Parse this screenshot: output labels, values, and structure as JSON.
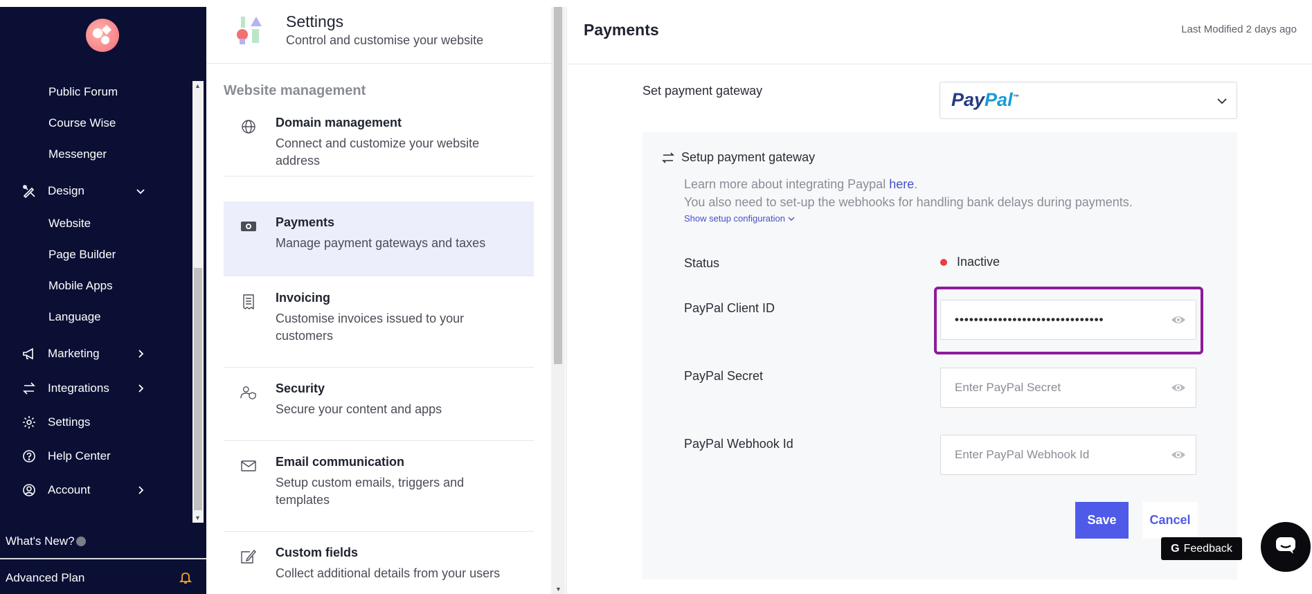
{
  "sidebar": {
    "sub_items_top": [
      "Public Forum",
      "Course Wise",
      "Messenger"
    ],
    "design": {
      "label": "Design",
      "icon": "design-pencil-icon",
      "expanded": true
    },
    "design_sub_items": [
      "Website",
      "Page Builder",
      "Mobile Apps",
      "Language"
    ],
    "main_items": [
      {
        "label": "Marketing",
        "icon": "megaphone-icon",
        "has_chevron": true
      },
      {
        "label": "Integrations",
        "icon": "arrows-exchange-icon",
        "has_chevron": true
      },
      {
        "label": "Settings",
        "icon": "gear-icon",
        "has_chevron": false
      },
      {
        "label": "Help Center",
        "icon": "question-circle-icon",
        "has_chevron": false
      },
      {
        "label": "Account",
        "icon": "user-circle-icon",
        "has_chevron": true
      }
    ],
    "whats_new": "What's New?",
    "plan": "Advanced Plan",
    "colors": {
      "background": "#0b0f33",
      "bell": "#f5a623"
    }
  },
  "settings_panel": {
    "title": "Settings",
    "subtitle": "Control and customise your website",
    "section": "Website management",
    "items": [
      {
        "title": "Domain management",
        "desc": "Connect and customize your website address",
        "icon": "globe-icon"
      },
      {
        "title": "Payments",
        "desc": "Manage payment gateways and taxes",
        "icon": "money-icon",
        "active": true
      },
      {
        "title": "Invoicing",
        "desc": "Customise invoices issued to your customers",
        "icon": "receipt-icon"
      },
      {
        "title": "Security",
        "desc": "Secure your content and apps",
        "icon": "user-shield-icon"
      },
      {
        "title": "Email communication",
        "desc": "Setup custom emails, triggers and templates",
        "icon": "envelope-icon"
      },
      {
        "title": "Custom fields",
        "desc": "Collect additional details from your users",
        "icon": "edit-form-icon"
      }
    ]
  },
  "payments": {
    "title": "Payments",
    "last_modified": "Last Modified 2 days ago",
    "gateway_label": "Set payment gateway",
    "gateway_value": {
      "part1": "Pay",
      "part2": "Pal",
      "mark": "™"
    },
    "setup_title": "Setup payment gateway",
    "learn_prefix": "Learn more about integrating Paypal ",
    "learn_link": "here",
    "learn_suffix": ".",
    "webhook_note": "You also need to set-up the webhooks for handling bank delays during payments.",
    "show_config": "Show setup configuration",
    "status_label": "Status",
    "status_value": "Inactive",
    "client_id_label": "PayPal Client ID",
    "client_id_value": "•••••••••••••••••••••••••••••••",
    "secret_label": "PayPal Secret",
    "secret_placeholder": "Enter PayPal Secret",
    "webhook_label": "PayPal Webhook Id",
    "webhook_placeholder": "Enter PayPal Webhook Id",
    "save": "Save",
    "cancel": "Cancel",
    "colors": {
      "primary": "#4f5be8",
      "status_inactive": "#ef3b44",
      "highlight": "#8e1a9c"
    }
  },
  "feedback": {
    "g": "G",
    "label": "Feedback"
  }
}
